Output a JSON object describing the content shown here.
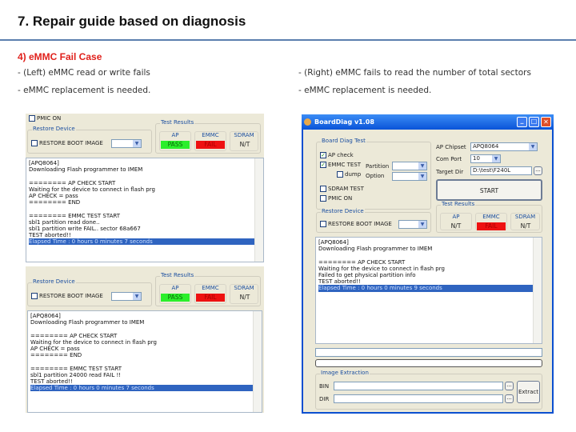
{
  "slide": {
    "title": "7. Repair guide based on diagnosis",
    "subtitle": "4) eMMC Fail Case",
    "left_notes": [
      "-  (Left) eMMC read or write fails",
      "-  eMMC replacement is needed."
    ],
    "right_notes": [
      "- (Right) eMMC fails to read the number of total sectors",
      "- eMMC replacement is needed."
    ]
  },
  "colors": {
    "pass": "#2bef2b",
    "fail": "#ee1111",
    "highlight": "#2f64c0",
    "accent_red": "#e0201b",
    "rule": "#5b7fae"
  },
  "left_top": {
    "pmic": "PMIC ON",
    "restore_group": "Restore Device",
    "restore_label": "RESTORE BOOT IMAGE",
    "results_group": "Test Results",
    "results": [
      {
        "name": "AP",
        "value": "PASS",
        "state": "pass"
      },
      {
        "name": "EMMC",
        "value": "FAIL",
        "state": "fail"
      },
      {
        "name": "SDRAM",
        "value": "N/T",
        "state": "nt"
      }
    ],
    "log": [
      "[APQ8064]",
      "Downloading Flash programmer to IMEM",
      "",
      "======== AP CHECK START",
      "Waiting for the device to connect in flash prg",
      "AP CHECK = pass",
      "======== END",
      "",
      "======== EMMC TEST START",
      "sbl1 partition read done..",
      "sbl1 partition write FAIL.. sector 68a667",
      "TEST aborted!!",
      "Elapsed Time : 0 hours 0 minutes 7 seconds"
    ]
  },
  "left_bottom": {
    "restore_group": "Restore Device",
    "restore_label": "RESTORE BOOT IMAGE",
    "results_group": "Test Results",
    "results": [
      {
        "name": "AP",
        "value": "PASS",
        "state": "pass"
      },
      {
        "name": "EMMC",
        "value": "FAIL",
        "state": "fail"
      },
      {
        "name": "SDRAM",
        "value": "N/T",
        "state": "nt"
      }
    ],
    "log": [
      "[APQ8064]",
      "Downloading Flash programmer to IMEM",
      "",
      "======== AP CHECK START",
      "Waiting for the device to connect in flash prg",
      "AP CHECK = pass",
      "======== END",
      "",
      "======== EMMC TEST START",
      "sbl1 partition 24000 read FAIL !!",
      "TEST aborted!!",
      "Elapsed Time : 0 hours 0 minutes 7 seconds"
    ]
  },
  "window": {
    "title": "BoardDiag v1.08",
    "diag_group": "Board Diag Test",
    "ap_check": "AP check",
    "emmc_test": "EMMC TEST",
    "partition": "Partition",
    "dump": "dump",
    "option": "Option",
    "sdram": "SDRAM TEST",
    "pmic": "PMIC ON",
    "ap_chipset_label": "AP Chipset",
    "ap_chipset": "APQ8064",
    "com_port_label": "Com Port",
    "com_port": "10",
    "target_dir_label": "Target Dir",
    "target_dir": "D:\\test\\F240L",
    "browse": "...",
    "start": "START",
    "results_group": "Test Results",
    "results": [
      {
        "name": "AP",
        "value": "N/T",
        "state": "nt"
      },
      {
        "name": "EMMC",
        "value": "FAIL",
        "state": "fail"
      },
      {
        "name": "SDRAM",
        "value": "N/T",
        "state": "nt"
      }
    ],
    "restore_group": "Restore Device",
    "restore_label": "RESTORE BOOT IMAGE",
    "log": [
      "[APQ8064]",
      "Downloading Flash programmer to IMEM",
      "",
      "======== AP CHECK START",
      "Waiting for the device to connect in flash prg",
      "Failed to get physical partition info",
      "TEST aborted!!",
      "Elapsed Time : 0 hours 0 minutes 9 seconds"
    ],
    "extract_group": "Image Extraction",
    "bin": "BIN",
    "dir": "DIR",
    "extract": "Extract"
  }
}
